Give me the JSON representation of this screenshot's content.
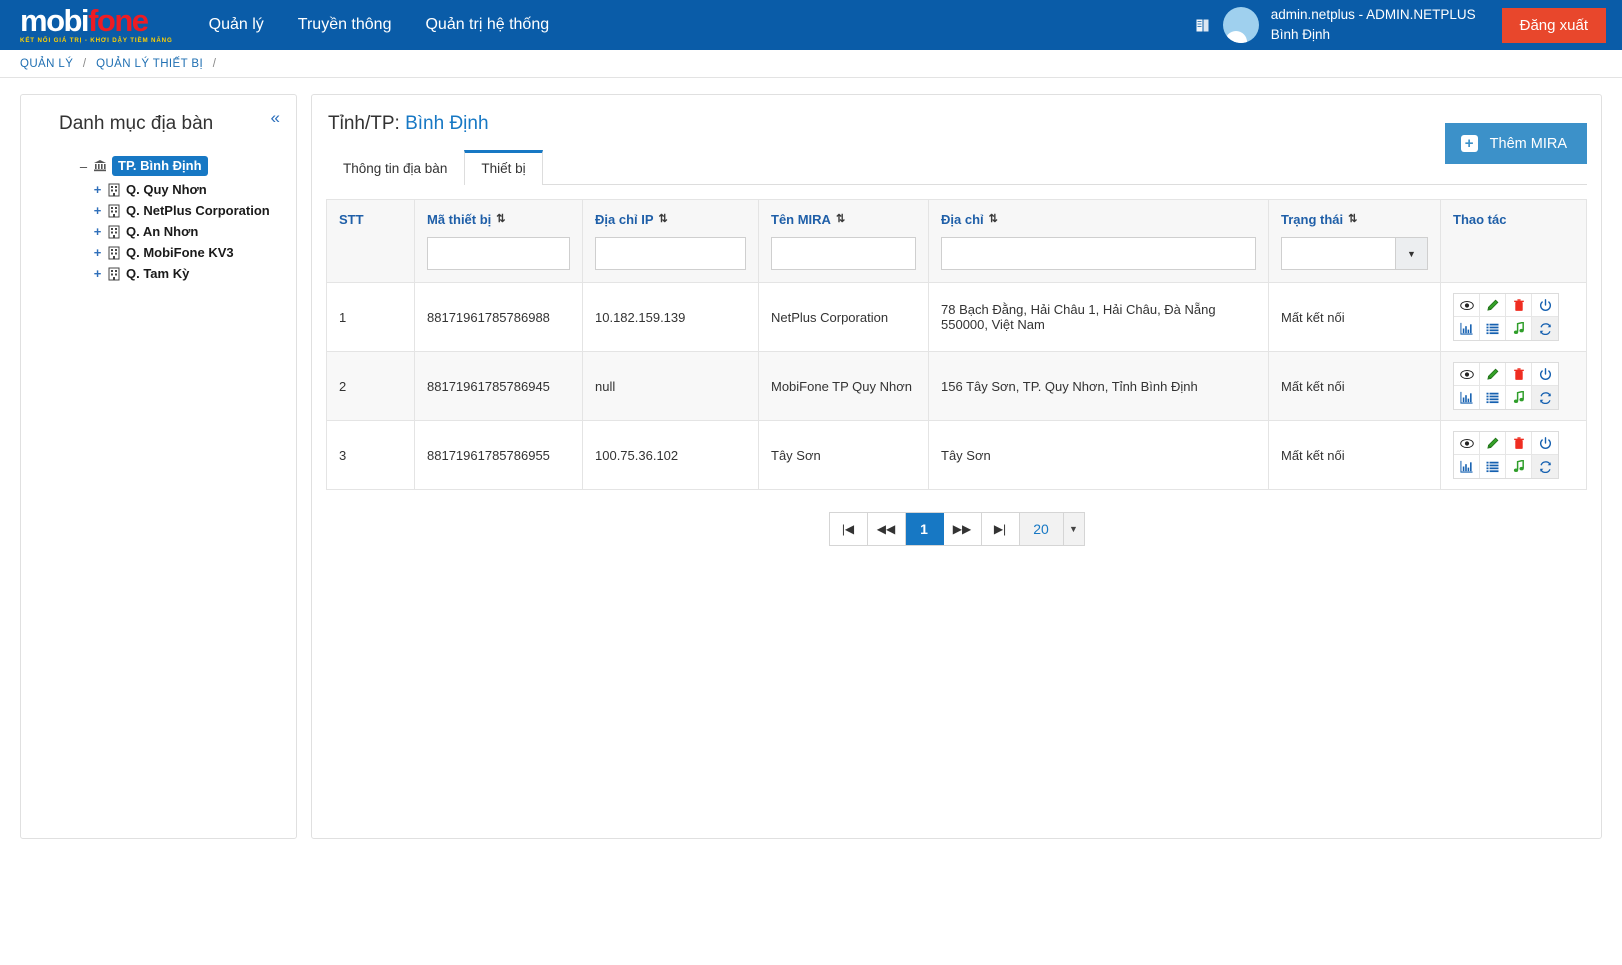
{
  "topbar": {
    "logo": {
      "part1": "mobi",
      "part2": "fone",
      "tagline": "KẾT NỐI GIÁ TRỊ  -  KHƠI DẬY TIỀM NĂNG"
    },
    "nav": [
      {
        "label": "Quản lý"
      },
      {
        "label": "Truyền thông"
      },
      {
        "label": "Quản trị hệ thống"
      }
    ],
    "user": {
      "line1": "admin.netplus - ADMIN.NETPLUS",
      "line2": "Bình Định"
    },
    "logout_label": "Đăng xuất",
    "colors": {
      "nav_bg": "#0a5ca8",
      "logout_bg": "#e8472c",
      "accent": "#1778c4"
    }
  },
  "breadcrumb": {
    "items": [
      "QUẢN LÝ",
      "QUẢN LÝ THIẾT BỊ"
    ],
    "separator": "/"
  },
  "sidebar": {
    "title": "Danh mục địa bàn",
    "collapse_label": "«",
    "tree": [
      {
        "toggle": "–",
        "icon": "bank-icon",
        "label": "TP. Bình Định",
        "selected": true,
        "level": 0
      },
      {
        "toggle": "+",
        "icon": "building-icon",
        "label": "Q. Quy Nhơn",
        "selected": false,
        "level": 1
      },
      {
        "toggle": "+",
        "icon": "building-icon",
        "label": "Q. NetPlus Corporation",
        "selected": false,
        "level": 1
      },
      {
        "toggle": "+",
        "icon": "building-icon",
        "label": "Q. An Nhơn",
        "selected": false,
        "level": 1
      },
      {
        "toggle": "+",
        "icon": "building-icon",
        "label": "Q. MobiFone KV3",
        "selected": false,
        "level": 1
      },
      {
        "toggle": "+",
        "icon": "building-icon",
        "label": "Q. Tam Kỳ",
        "selected": false,
        "level": 1
      }
    ]
  },
  "main": {
    "title_prefix": "Tỉnh/TP:",
    "title_value": "Bình Định",
    "tabs": [
      {
        "label": "Thông tin địa bàn",
        "active": false
      },
      {
        "label": "Thiết bị",
        "active": true
      }
    ],
    "add_button": {
      "label": "Thêm MIRA",
      "icon": "plus-icon"
    }
  },
  "table": {
    "columns": [
      {
        "label": "STT",
        "sortable": false,
        "filter": "none"
      },
      {
        "label": "Mã thiết bị",
        "sortable": true,
        "filter": "text"
      },
      {
        "label": "Địa chỉ IP",
        "sortable": true,
        "filter": "text"
      },
      {
        "label": "Tên MIRA",
        "sortable": true,
        "filter": "text"
      },
      {
        "label": "Địa chỉ",
        "sortable": true,
        "filter": "text"
      },
      {
        "label": "Trạng thái",
        "sortable": true,
        "filter": "select"
      },
      {
        "label": "Thao tác",
        "sortable": false,
        "filter": "none"
      }
    ],
    "filters": {
      "ma_thiet_bi": "",
      "dia_chi_ip": "",
      "ten_mira": "",
      "dia_chi": "",
      "trang_thai": ""
    },
    "rows": [
      {
        "stt": "1",
        "ma_thiet_bi": "88171961785786988",
        "dia_chi_ip": "10.182.159.139",
        "ten_mira": "NetPlus Corporation",
        "dia_chi": "78 Bạch Đằng, Hải Châu 1, Hải Châu, Đà Nẵng 550000, Việt Nam",
        "trang_thai": "Mất kết nối"
      },
      {
        "stt": "2",
        "ma_thiet_bi": "88171961785786945",
        "dia_chi_ip": "null",
        "ten_mira": "MobiFone TP Quy Nhơn",
        "dia_chi": "156 Tây Sơn, TP. Quy Nhơn, Tỉnh Bình Định",
        "trang_thai": "Mất kết nối"
      },
      {
        "stt": "3",
        "ma_thiet_bi": "88171961785786955",
        "dia_chi_ip": "100.75.36.102",
        "ten_mira": "Tây Sơn",
        "dia_chi": "Tây Sơn",
        "trang_thai": "Mất kết nối"
      }
    ],
    "row_actions": [
      "view-eye-icon",
      "edit-pencil-icon",
      "delete-trash-icon",
      "power-toggle-icon",
      "statistics-chart-icon",
      "log-list-icon",
      "audio-music-icon",
      "sync-refresh-icon"
    ],
    "status_color": "#e8362c"
  },
  "pagination": {
    "first_label": "|◀",
    "prev_label": "◀◀",
    "current_page": "1",
    "next_label": "▶▶",
    "last_label": "▶|",
    "page_size": "20",
    "page_size_arrow": "chevron-down-icon"
  }
}
